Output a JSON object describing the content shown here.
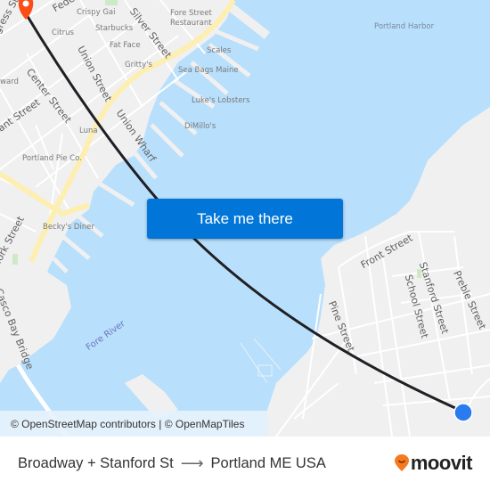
{
  "map": {
    "labels": {
      "pois": {
        "crispy_gai": "Crispy Gai",
        "citrus": "Citrus",
        "starbucks": "Starbucks",
        "fat_face": "Fat Face",
        "grittys": "Gritty's",
        "fore_street_restaurant_1": "Fore Street",
        "fore_street_restaurant_2": "Restaurant",
        "scales": "Scales",
        "sea_bags": "Sea Bags Maine",
        "lukes": "Luke's Lobsters",
        "dimillos": "DiMillo's",
        "luna": "Luna",
        "portland_pie": "Portland Pie Co.",
        "beckys": "Becky's Diner",
        "ward": "ward"
      },
      "streets": {
        "congress": "gress St",
        "federal": "Fede",
        "silver": "Silver Street",
        "union": "Union Street",
        "center": "Center Street",
        "union_wharf": "Union Wharf",
        "pleasant": "sant Street",
        "york": "York Street",
        "casco_bridge": "Casco Bay Bridge",
        "front": "Front Street",
        "stanford": "Stanford Street",
        "school": "School Street",
        "preble": "Preble Street",
        "pine": "Pine Street"
      },
      "water": {
        "portland_harbor": "Portland Harbor",
        "fore_river": "Fore River"
      }
    },
    "origin_marker": {
      "name": "Broadway + Stanford St",
      "color": "#2b7bf0"
    },
    "destination_marker": {
      "name": "Portland ME USA",
      "color": "#fb4d14"
    },
    "route_color": "#1f1f24",
    "cta_label": "Take me there",
    "attribution": "© OpenStreetMap contributors | © OpenMapTiles"
  },
  "footer": {
    "origin": "Broadway + Stanford St",
    "arrow": "⟶",
    "destination": "Portland ME USA",
    "brand": "moovit",
    "brand_color": "#f5791f"
  }
}
